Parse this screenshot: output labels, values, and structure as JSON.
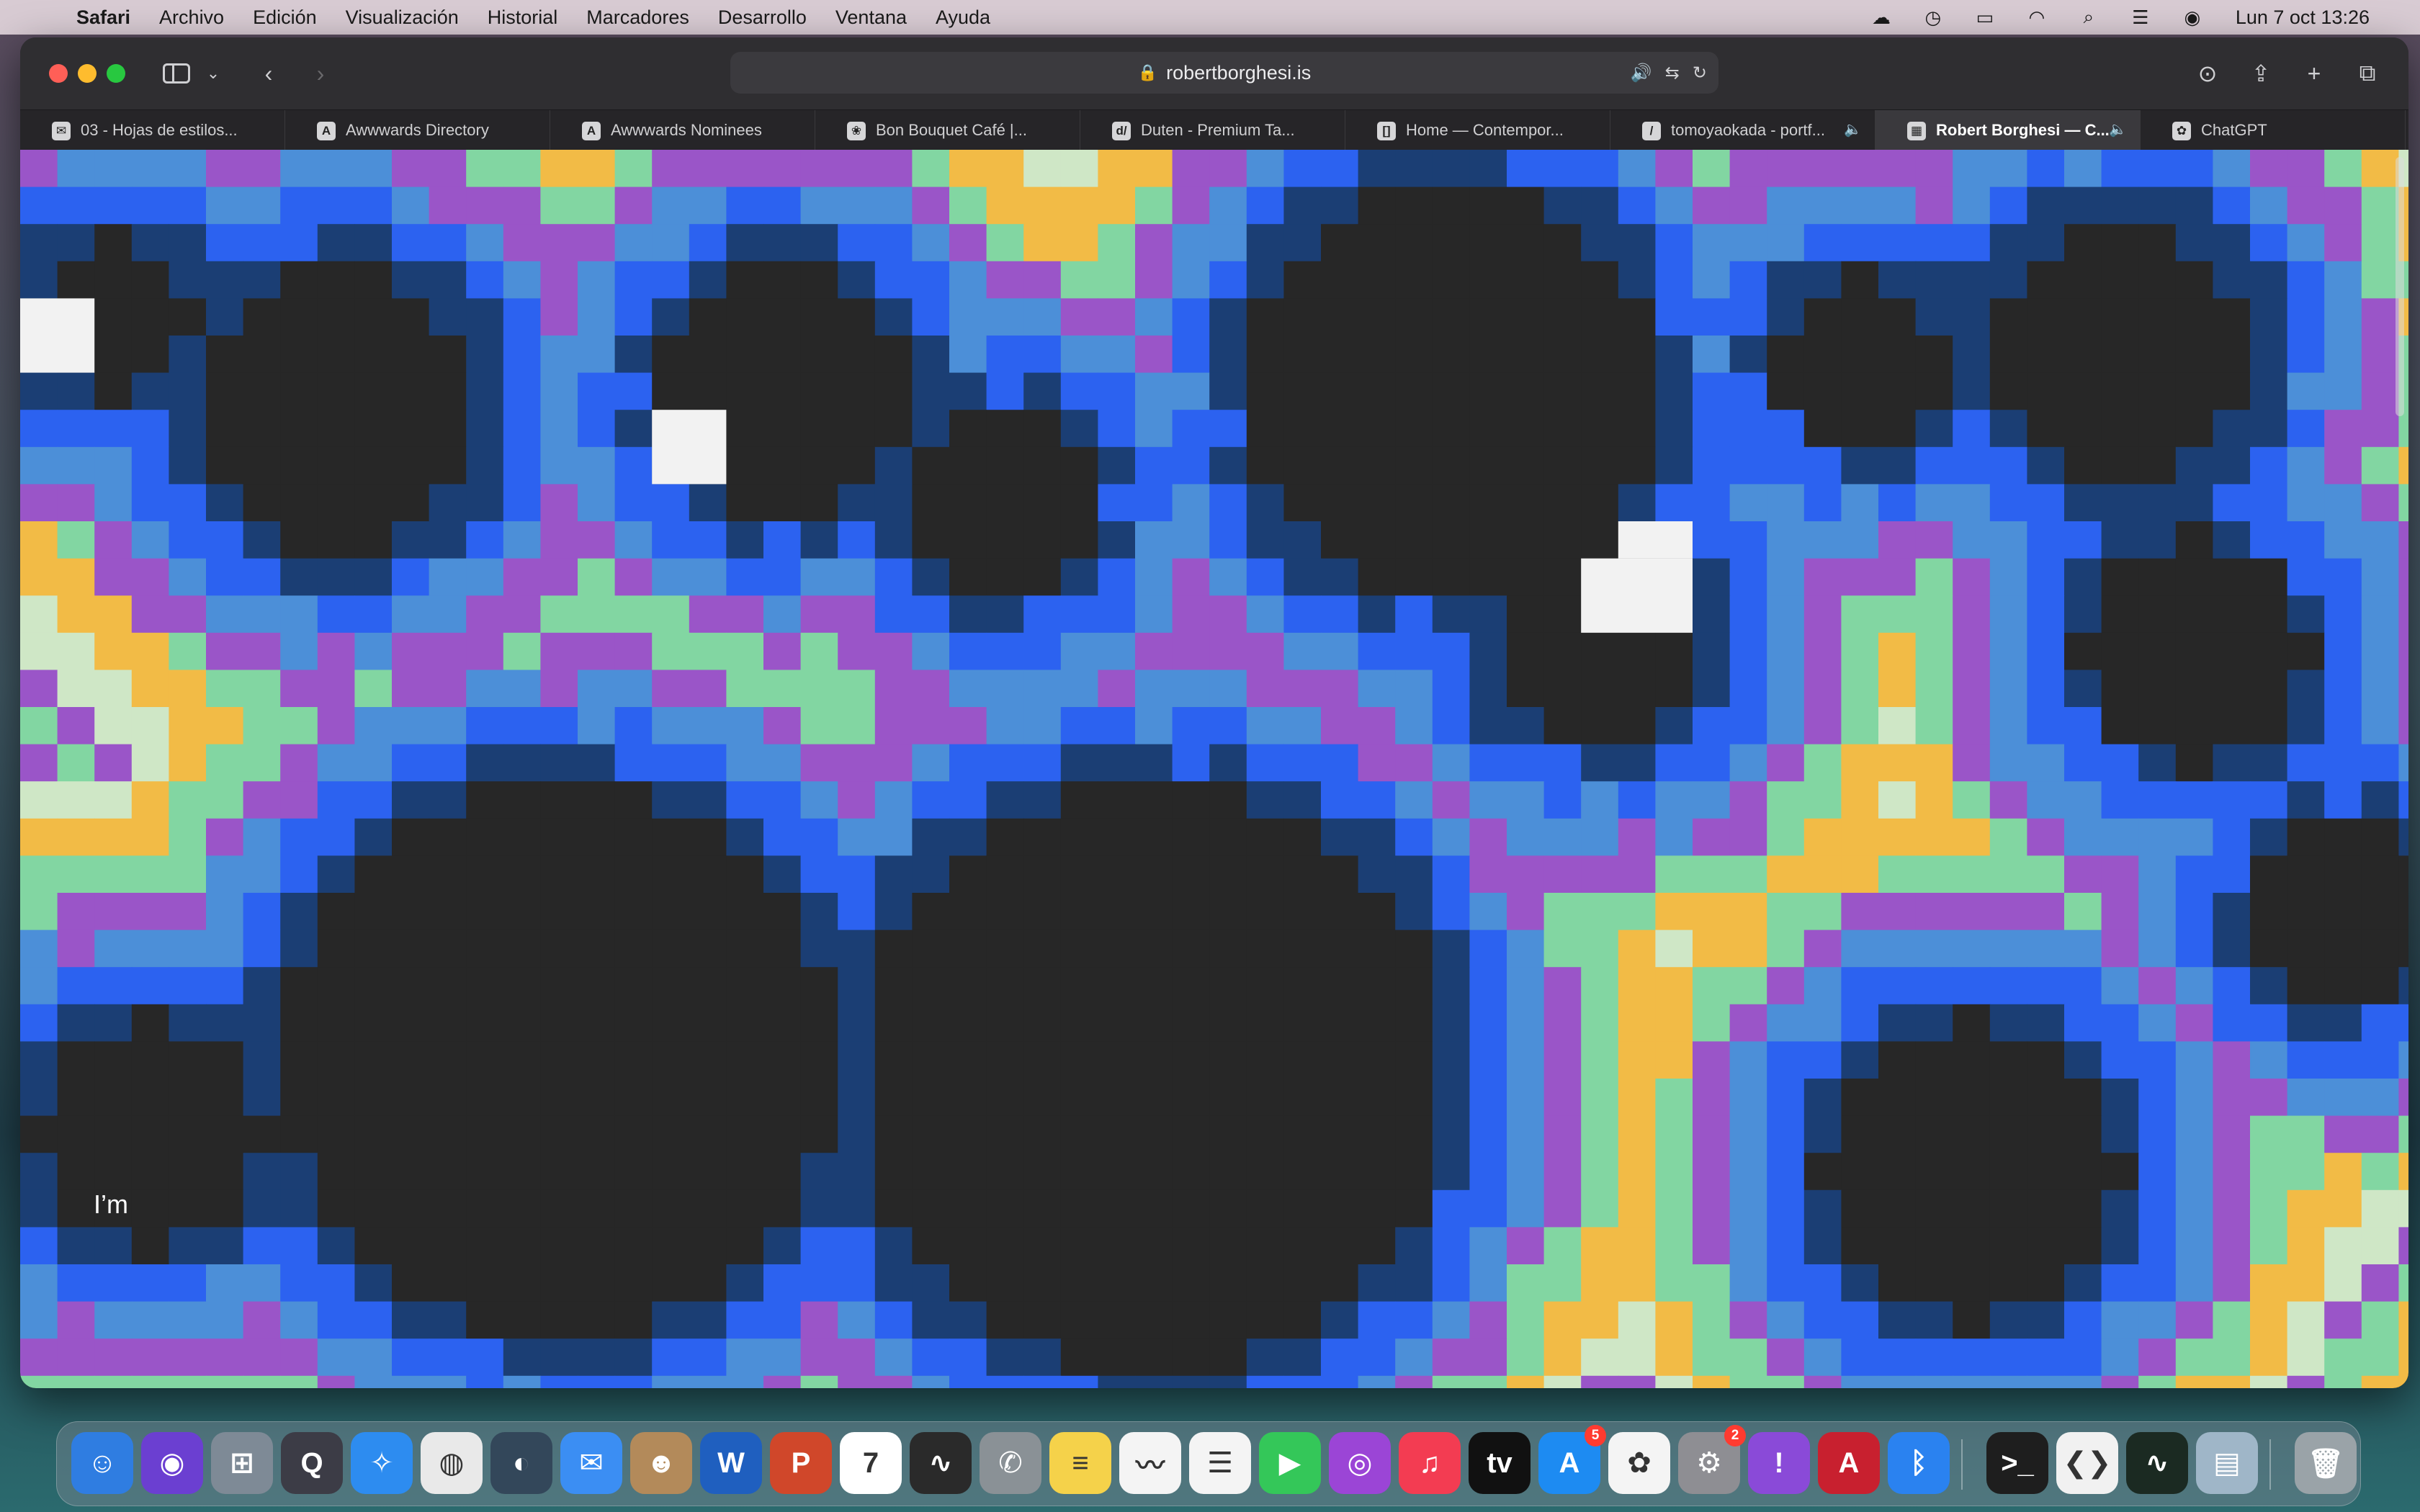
{
  "menubar": {
    "app_name": "Safari",
    "items": [
      "Archivo",
      "Edición",
      "Visualización",
      "Historial",
      "Marcadores",
      "Desarrollo",
      "Ventana",
      "Ayuda"
    ],
    "clock": "Lun 7 oct  13:26",
    "status_icons": [
      "creative-cloud-icon",
      "time-machine-icon",
      "battery-icon",
      "wifi-icon",
      "spotlight-search-icon",
      "control-center-icon",
      "siri-icon"
    ]
  },
  "browser": {
    "url": "robertborghesi.is",
    "tabs": [
      {
        "title": "03 - Hojas de estilos...",
        "fav": "✉"
      },
      {
        "title": "Awwwards Directory",
        "fav": "A"
      },
      {
        "title": "Awwwards Nominees",
        "fav": "A"
      },
      {
        "title": "Bon Bouquet Café |...",
        "fav": "❀"
      },
      {
        "title": "Duten - Premium Ta...",
        "fav": "d/"
      },
      {
        "title": "Home — Contempor...",
        "fav": "[]"
      },
      {
        "title": "tomoyaokada - portf...",
        "fav": "/"
      },
      {
        "title": "Robert Borghesi — C...",
        "fav": "▦",
        "active": true
      },
      {
        "title": "ChatGPT",
        "fav": "✿"
      }
    ]
  },
  "page": {
    "intro_text": "I’m",
    "palette": {
      "dark": "#272727",
      "purple": "#9a55c8",
      "mint": "#82d6a2",
      "yellow": "#f2bb46",
      "royal": "#2c62f0",
      "navy": "#1b3e74",
      "skyblue": "#4c8fd8",
      "pale": "#cfe7c6",
      "white": "#f2f2f2"
    }
  },
  "dock": {
    "apps": [
      {
        "name": "finder",
        "glyph": "☺",
        "color": "#2f7de1"
      },
      {
        "name": "siri",
        "glyph": "◉",
        "color": "#6b3fd1"
      },
      {
        "name": "launchpad",
        "glyph": "⊞",
        "color": "#7e8a96"
      },
      {
        "name": "quicktime",
        "glyph": "Q",
        "color": "#3c3c46"
      },
      {
        "name": "safari",
        "glyph": "✧",
        "color": "#2d8cf0"
      },
      {
        "name": "chrome",
        "glyph": "◍",
        "color": "#e9e9e9"
      },
      {
        "name": "network-radar",
        "glyph": "◐",
        "color": "#33475a"
      },
      {
        "name": "mail",
        "glyph": "✉",
        "color": "#3b8ef3"
      },
      {
        "name": "contacts",
        "glyph": "☻",
        "color": "#b38a5a"
      },
      {
        "name": "word",
        "glyph": "W",
        "color": "#1f5fbf"
      },
      {
        "name": "powerpoint",
        "glyph": "P",
        "color": "#d0472a"
      },
      {
        "name": "calendar",
        "glyph": "7",
        "color": "#ffffff"
      },
      {
        "name": "voice-memos",
        "glyph": "∿",
        "color": "#2a2a2a"
      },
      {
        "name": "whatsapp",
        "glyph": "✆",
        "color": "#8a9196"
      },
      {
        "name": "notes",
        "glyph": "≡",
        "color": "#f5d24a"
      },
      {
        "name": "freeform",
        "glyph": "〰",
        "color": "#f4f4f4"
      },
      {
        "name": "reminders",
        "glyph": "☰",
        "color": "#f4f4f4"
      },
      {
        "name": "facetime",
        "glyph": "▶",
        "color": "#34c759"
      },
      {
        "name": "podcasts",
        "glyph": "◎",
        "color": "#9b45d6"
      },
      {
        "name": "music",
        "glyph": "♫",
        "color": "#f33c52"
      },
      {
        "name": "apple-tv",
        "glyph": "tv",
        "color": "#111111"
      },
      {
        "name": "app-store",
        "glyph": "A",
        "color": "#1d8bf2",
        "badge": "5"
      },
      {
        "name": "photos",
        "glyph": "✿",
        "color": "#f4f4f4"
      },
      {
        "name": "system-settings",
        "glyph": "⚙",
        "color": "#8e8e93",
        "badge": "2"
      },
      {
        "name": "feedback",
        "glyph": "!",
        "color": "#8a4ad8"
      },
      {
        "name": "autocad",
        "glyph": "A",
        "color": "#c8202f"
      },
      {
        "name": "bluetooth",
        "glyph": "ᛒ",
        "color": "#2a82f0"
      },
      {
        "name": "terminal",
        "glyph": ">_",
        "color": "#1e1e1e"
      },
      {
        "name": "vscode",
        "glyph": "❮❯",
        "color": "#f1f1f1"
      },
      {
        "name": "activity-monitor",
        "glyph": "∿",
        "color": "#1b2a22"
      },
      {
        "name": "preview",
        "glyph": "▤",
        "color": "#9fb6c8"
      },
      {
        "name": "trash",
        "glyph": "🗑",
        "color": "#9aa3a8"
      }
    ]
  }
}
